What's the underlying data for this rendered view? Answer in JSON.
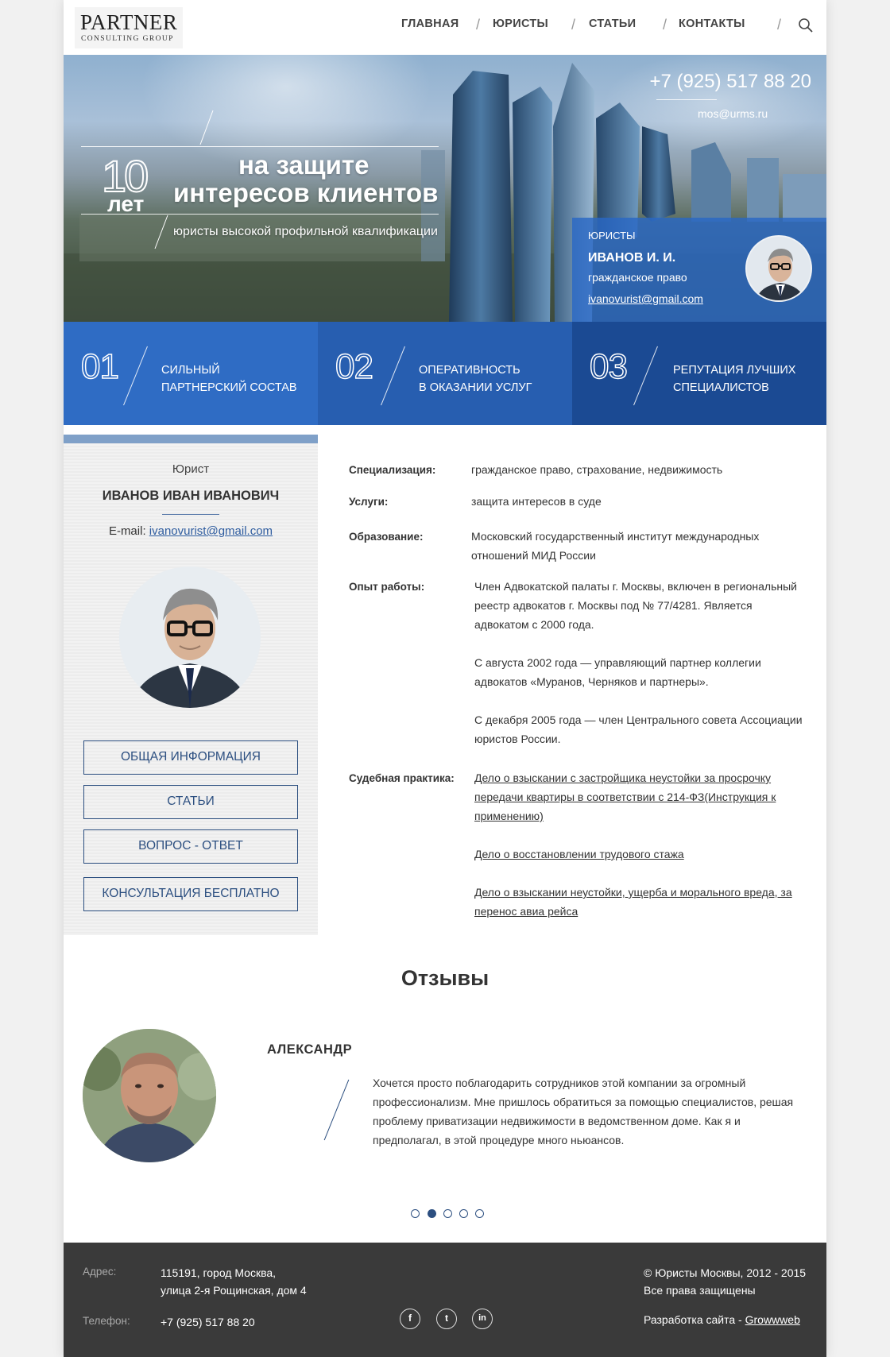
{
  "header": {
    "logo_main": "PARTNER",
    "logo_sub": "CONSULTING GROUP",
    "nav": [
      "ГЛАВНАЯ",
      "ЮРИСТЫ",
      "СТАТЬИ",
      "КОНТАКТЫ"
    ],
    "separator": "/"
  },
  "hero": {
    "years_number": "10",
    "years_word": "лет",
    "title_line1": "на защите",
    "title_line2": "интересов клиентов",
    "subtitle": "юристы высокой профильной квалификации",
    "phone": "+7 (925) 517 88 20",
    "email": "mos@urms.ru",
    "card": {
      "label": "ЮРИСТЫ",
      "name": "ИВАНОВ И. И.",
      "specialization": "гражданское право",
      "email": "ivanovurist@gmail.com"
    }
  },
  "features": [
    {
      "num": "01",
      "line1": "СИЛЬНЫЙ",
      "line2": "ПАРТНЕРСКИЙ СОСТАВ",
      "color": "#2f6cc4"
    },
    {
      "num": "02",
      "line1": "ОПЕРАТИВНОСТЬ",
      "line2": "В ОКАЗАНИИ УСЛУГ",
      "color": "#275eb0"
    },
    {
      "num": "03",
      "line1": "РЕПУТАЦИЯ ЛУЧШИХ",
      "line2": "СПЕЦИАЛИСТОВ",
      "color": "#1b4a93"
    }
  ],
  "sidebar": {
    "role": "Юрист",
    "name": "ИВАНОВ ИВАН ИВАНОВИЧ",
    "email_label": "E-mail:",
    "email": "ivanovurist@gmail.com",
    "buttons": [
      "ОБЩАЯ ИНФОРМАЦИЯ",
      "СТАТЬИ",
      "ВОПРОС - ОТВЕТ",
      "КОНСУЛЬТАЦИЯ БЕСПЛАТНО"
    ]
  },
  "details": {
    "spec_label": "Специализация:",
    "spec_value": "гражданское право, страхование, недвижимость",
    "services_label": "Услуги:",
    "services_value": "защита интересов в суде",
    "edu_label": "Образование:",
    "edu_line1": "Московский государственный институт международных",
    "edu_line2": "отношений МИД России",
    "exp_label": "Опыт работы:",
    "exp_lines": [
      "Член Адвокатской палаты г. Москвы, включен в региональный",
      "реестр адвокатов г. Москвы под № 77/4281. Является",
      "адвокатом с 2000 года.",
      "С августа 2002 года — управляющий партнер коллегии",
      "адвокатов «Муранов, Черняков и партнеры».",
      "С декабря 2005 года — член Центрального совета Ассоциации",
      "юристов России."
    ],
    "court_label": "Судебная практика:",
    "court_lines": [
      "Дело о взыскании с застройщика неустойки за просрочку",
      "передачи квартиры в соответствии с 214-ФЗ(Инструкция к",
      "применению)",
      "Дело о восстановлении трудового стажа",
      "Дело о взыскании неустойки, ущерба и морального вреда, за",
      "перенос авиа рейса"
    ]
  },
  "reviews": {
    "title": "Отзывы",
    "name": "АЛЕКСАНДР",
    "text_lines": [
      "Хочется просто поблагодарить сотрудников этой компании за огромный",
      "профессионализм. Мне пришлось обратиться за помощью специалистов, решая",
      "проблему приватизации недвижимости в ведомственном доме. Как я и",
      "предполагал, в этой процедуре много ньюансов."
    ],
    "pager_count": 5,
    "pager_active": 2
  },
  "footer": {
    "address_label": "Адрес:",
    "address_line1": "115191, город Москва,",
    "address_line2": "улица 2-я Рощинская, дом 4",
    "phone_label": "Телефон:",
    "phone": "+7 (925) 517 88 20",
    "social": [
      "f",
      "t",
      "in"
    ],
    "copyright": "© Юристы Москвы, 2012 - 2015",
    "rights": "Все права защищены",
    "dev_text": "Разработка сайта -",
    "dev_link": "Growwweb"
  }
}
